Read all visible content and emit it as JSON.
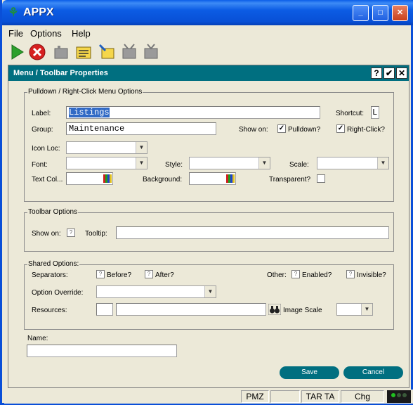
{
  "window": {
    "title": "APPX"
  },
  "menubar": {
    "items": [
      "File",
      "Options",
      "Help"
    ]
  },
  "dialog": {
    "title": "Menu / Toolbar Properties",
    "header_buttons": [
      "?",
      "✔",
      "✕"
    ],
    "pulldown": {
      "group_title": "Pulldown / Right-Click Menu Options",
      "label_lbl": "Label:",
      "label_value": "Listings",
      "shortcut_lbl": "Shortcut:",
      "shortcut_value": "L",
      "group_lbl": "Group:",
      "group_value": "Maintenance",
      "show_on_lbl": "Show on:",
      "pulldown_lbl": "Pulldown?",
      "pulldown_checked": true,
      "rightclick_lbl": "Right-Click?",
      "rightclick_checked": true,
      "icon_loc_lbl": "Icon Loc:",
      "font_lbl": "Font:",
      "style_lbl": "Style:",
      "scale_lbl": "Scale:",
      "text_col_lbl": "Text Col...",
      "background_lbl": "Background:",
      "transparent_lbl": "Transparent?"
    },
    "toolbar_opts": {
      "group_title": "Toolbar Options",
      "show_on_lbl": "Show on:",
      "tooltip_lbl": "Tooltip:",
      "tooltip_value": ""
    },
    "shared": {
      "group_title": "Shared Options:",
      "separators_lbl": "Separators:",
      "before_lbl": "Before?",
      "after_lbl": "After?",
      "other_lbl": "Other:",
      "enabled_lbl": "Enabled?",
      "invisible_lbl": "Invisible?",
      "option_override_lbl": "Option Override:",
      "resources_lbl": "Resources:",
      "image_scale_lbl": "Image Scale"
    },
    "name_lbl": "Name:",
    "name_value": "",
    "save_label": "Save",
    "cancel_label": "Cancel"
  },
  "statusbar": {
    "cells": [
      "PMZ",
      "",
      "TAR TA",
      "Chg"
    ]
  },
  "colors": {
    "accent": "#006f80",
    "titlebar": "#0a5ee8"
  }
}
